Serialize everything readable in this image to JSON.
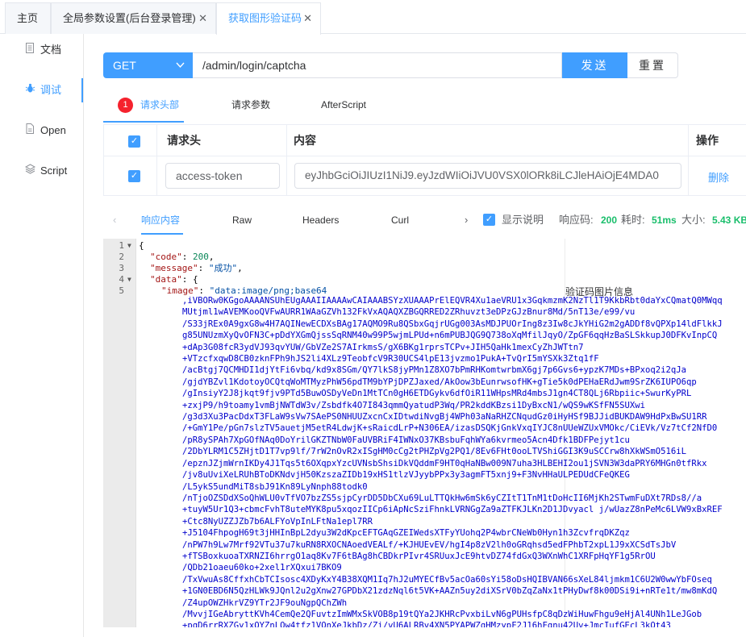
{
  "tabs": [
    {
      "label": "主页",
      "closable": false
    },
    {
      "label": "全局参数设置(后台登录管理)",
      "closable": true
    },
    {
      "label": "获取图形验证码",
      "closable": true,
      "active": true
    }
  ],
  "close_glyph": "✕",
  "sidebar": {
    "items": [
      {
        "label": "文档",
        "icon": "document-icon"
      },
      {
        "label": "调试",
        "icon": "bug-icon",
        "active": true
      },
      {
        "label": "Open",
        "icon": "file-icon"
      },
      {
        "label": "Script",
        "icon": "code-icon"
      }
    ]
  },
  "request": {
    "method": "GET",
    "url": "/admin/login/captcha",
    "send_label": "发送",
    "reset_label": "重置"
  },
  "req_tabs": {
    "badge": "1",
    "headers_label": "请求头部",
    "params_label": "请求参数",
    "afterscript_label": "AfterScript"
  },
  "header_table": {
    "col_name": "请求头",
    "col_content": "内容",
    "col_action": "操作",
    "rows": [
      {
        "name": "access-token",
        "value": "eyJhbGciOiJIUzI1NiJ9.eyJzdWIiOiJVU0VSX0lORk8iLCJleHAiOjE4MDA0",
        "action": "删除"
      }
    ]
  },
  "response": {
    "tabs": [
      "响应内容",
      "Raw",
      "Headers",
      "Curl"
    ],
    "show_desc_label": "显示说明",
    "code_label": "响应码:",
    "code_value": "200",
    "time_label": "耗时:",
    "time_value": "51ms",
    "size_label": "大小:",
    "size_value": "5.43 KB",
    "field_desc": "验证码图片信息",
    "line_numbers": [
      "1",
      "2",
      "3",
      "4",
      "5"
    ],
    "code_key": "\"code\"",
    "code_num": "200",
    "message_key": "\"message\"",
    "message_val": "\"成功\"",
    "data_key": "\"data\"",
    "image_key": "\"image\"",
    "image_prefix": "\"data:image/png;base64",
    "image_base64": ",iVBORw0KGgoAAAANSUhEUgAAAIIAAAAwCAIAAABSYzXUAAAPrElEQVR4Xu1aeVRU1x3GqkmzmK2NzTl1T9KkbRbt0daYxCQmatQ0MWqq\nMUtjml1wAVEMKooQVFwAURR1WAaGZVh132FkVxAQAQXZBGQRRED2ZRhuvzt3eDPzGJzBnur8Md/5nT13e/e99/vu\n/S33jREx0A9gxG8w4H7AQINewECDXsBAg17AQMO9Ru8QSbxGqjrUGg003AsMDJPUOrIng8z3Iw8cJkYHiG2m2gADDf8vQPXp14ldFlkkJ\ng85UNUzmXyQvOFN3C+pDdYXGmQjssSqRNM40w99P5wjmLPUd+n6mPUBJQG9Q738oXqMfilJqyO/ZpGF6qqHzBaSLSkkupJ0DFKvInpCQ\n+dAp3G08fcR3ydVJ93qvYUW/GbVZe2S7AIrkmsS/gX6BKg1rprsTCPv+JIH5QaHk1mexCyZhJWTtn7\n+VTzcfxqwD8CB0zknFPh9hJS2li4XLz9TeobfcV9R30UCS4lpE13jvzmo1PukA+TvQrI5mYSXk3Ztq1fF\n/acBtgj7QCMHDI1djYtFi6vbq/kd9x8SGm/QY7lkS8jyPMn1Z8XO7bPmRHKomtwrbmX6gj7p6Gvs6+ypzK7MDs+BPxoq2i2qJa\n/gjdYBZvl1KdotoyOCQtqWoMTMyzPhW56pdTM9bYPjDPZJaxed/AkOow3bEunrwsofHK+gTie5k0dPEHaERdJwm9SrZK6IUPO6qp\n/gInsiyY2J8jkqt9fjv9PTd5BuwOSDyVeDn1MtTCn0gH6ETDGykv6dfOiR11WHpsMRd4mbsJ1gn4CT8QLj6Rbpiic+SwurKyPRL\n+zxjP9/h9toamy1vmBjNWTdW3v/Zsbdfk4O7I843qmmQyatudP3Wq/PR2kddKBzsi1DyBxcN1/wQS9wKSfFN5SUXwi\n/g3d3Xu3PacDdxT3FLaW9sVw7SAePS0NHUUZxcnCxIDtwdiNvgBj4WPh03aNaRHZCNqudGz0iHyHSf9BJJidBUKDAW9HdPxBwSU1RR\n/+GmY1Pe/pGn7slzTV5auetjM5etR4LdwjK+sRaicdLrP+N306EA/izasDSQKjGnkVxqIYJC8nUUeWZUxVMOkc/CiEVk/Vz7tCf2NfD0\n/pR8ySPAh7XpGOfNAq0DoYrilGKZTNbW0FaUVBRiF4IWNxO37KBsbuFqhWYa6kvrmeo5Acn4Dfk1BDFPejyt1cu\n/2DbYLRM1C5ZHjtD1T7vp9lf/7rW2nOvR2xISgHM0cCg2tPHZpVg2PQ1/8Ev6FHt0ooLTVShiGGI3K9uSCCrw8hXkWSmO516iL\n/epznJZjmWrnIKDy4J1Tqs5t6OXqpxYzcUVNsbShsiDkVQddmF9HT0qHaNBw009N7uha3HLBEHI2ou1jSVN3W3daPRY6MHGn0tfRkx\n/jv8uUviXeLRUhBToDKNdvjH50KzszaZIDb19xHS1tlzVJyybPPx3y3agmFT5xnj9+F3NvHHaULPEDUdCFeQKEG\n/L5ykS5undMiT8sbJ91Kn89LyNnph88todk0\n/nTjoOZSDdXSoQhWLU0vTfVO7bzZS5sjpCyrDD5DbCXu69LuLTTQkHw6mSk6yCZItT1TnM1tDoHcII6MjKh2STwmFuDXt7RDs8//a\n+tuyW5Ur1Q3+cbmcFvhT8uteMYK8pu5xqozIICp6iApNcSziFhnkLVRNGgZa9aZTFKJLKn2D1JDvyacl j/wUazZ8nPeMc6LVW9xBxREF\n+Ctc8NyUZZJZb7b6ALFYoVpInLFtNa1epl7RR\n+J5104FhpogH69t3jHHInBpL2dyu3W2dKpcEFTGAqGZEIWedsXTFyYUohq2P4wbrCNeWb0Hyn1h3ZcvfrqDKZqz\n/nPW7h9Lw7Mrf92VTu37u7kuRN8RXOCNAoedVEALf/+KJHUEvEV/hgI4p8zV2lh0oGRqhsd5edFPhbT2xpL1J9xXCSdTsJbV\n+fTSBoxkuoaTXRNZI6hrrgO1aq8Kv7F6tBAg8hCBDkrPIvr4SRUuxJcE9htvDZ74fdGxQ3WXnWhC1XRFpHqYF1g5RrOU\n/QDb21oaeu60ko+2xel1rXQxui7BKO9\n/TxVwuAs8CffxhCbTCIsosc4XDyKxY4B38XQM1Iq7hJ2uMYECfBv5acOa60sYi58oDsHQIBVAN66sXeL84ljmkm1C6U2W0wwYbFOseq\n+1GN0EBD6N5QzHLWk9JQnl2u2gXnw27GPDbX21zdzNql6t5VK+AAZn5uy2diXSrV0bZqZaNx1tPHyDwf8k00DSi9i+nRTe1t/mw8mKdQ\n/Z4upOWZHkrVZ9YTr2JF9ouNgpQChZWh\n/MvvjIGeAbryttKVh4CemQe2QFuvtzImWMxSkVOB8p19tQYa2JKHRcPvxbiLvN6gPUHsfpC8qDzWiHuwFhgu9eHjAl4UNh1LeJGob\n+pqD6rrRXZGy1xOYZnLQw4tfz1VOnXeJkbDz/Zi/vU6ALRBv4XN5PYAPWZgHMzypF2J16hFgnu42Uv+JmcIufGEcL3kOt43"
  }
}
